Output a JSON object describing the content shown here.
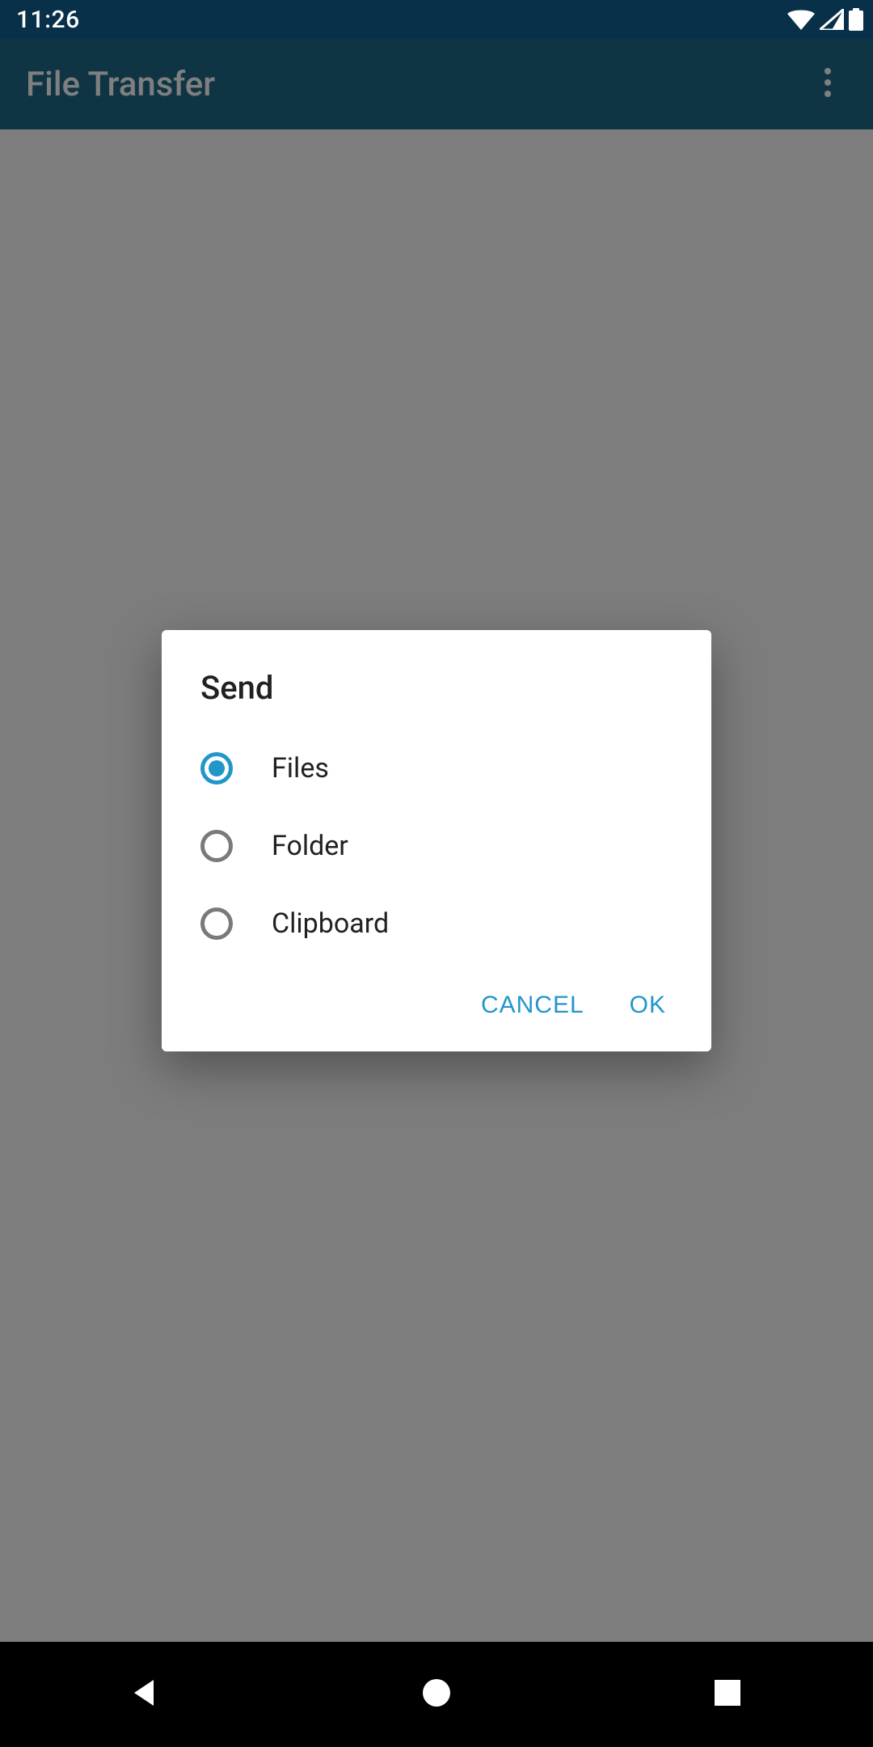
{
  "status": {
    "time": "11:26"
  },
  "appbar": {
    "title": "File Transfer"
  },
  "dialog": {
    "title": "Send",
    "options": [
      {
        "label": "Files",
        "selected": true
      },
      {
        "label": "Folder",
        "selected": false
      },
      {
        "label": "Clipboard",
        "selected": false
      }
    ],
    "cancel_label": "CANCEL",
    "ok_label": "OK"
  },
  "colors": {
    "accent": "#2196c9",
    "appbar_bg": "#1f6a89",
    "status_bg": "#083048"
  }
}
